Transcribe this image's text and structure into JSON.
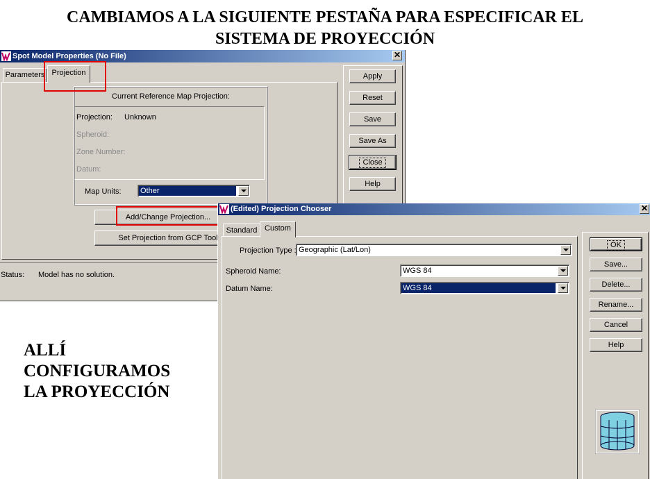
{
  "headings": {
    "line1": "CAMBIAMOS A LA SIGUIENTE PESTAÑA PARA ESPECIFICAR EL",
    "line2": "SISTEMA DE PROYECCIÓN"
  },
  "side_note": {
    "line1": "ALLÍ",
    "line2": "CONFIGURAMOS",
    "line3": "LA PROYECCIÓN"
  },
  "spot_window": {
    "title": "Spot Model Properties (No File)",
    "close_glyph": "✕",
    "tabs": [
      {
        "label": "Parameters",
        "active": false
      },
      {
        "label": "Projection",
        "active": true
      }
    ],
    "group_title": "Current Reference Map Projection:",
    "fields": {
      "projection_label": "Projection:",
      "projection_value": "Unknown",
      "spheroid_label": "Spheroid:",
      "zone_label": "Zone Number:",
      "datum_label": "Datum:"
    },
    "map_units": {
      "label": "Map Units:",
      "value": "Other"
    },
    "buttons": {
      "add_change": "Add/Change Projection...",
      "set_from_gcp": "Set Projection from GCP Tool"
    },
    "side_buttons": {
      "apply": "Apply",
      "reset": "Reset",
      "save": "Save",
      "save_as": "Save As",
      "close": "Close",
      "help": "Help"
    },
    "status": {
      "label": "Status:",
      "value": "Model has no solution."
    }
  },
  "chooser_window": {
    "title": "(Edited) Projection Chooser",
    "close_glyph": "✕",
    "tabs": [
      {
        "label": "Standard",
        "active": false
      },
      {
        "label": "Custom",
        "active": true
      }
    ],
    "projection_type": {
      "label": "Projection Type :",
      "value": "Geographic (Lat/Lon)"
    },
    "spheroid": {
      "label": "Spheroid Name:",
      "value": "WGS 84"
    },
    "datum": {
      "label": "Datum Name:",
      "value": "WGS 84"
    },
    "buttons": {
      "ok": "OK",
      "save": "Save...",
      "delete": "Delete...",
      "rename": "Rename...",
      "cancel": "Cancel",
      "help": "Help"
    }
  },
  "colors": {
    "title_active": "#0a246a",
    "title_fade": "#a6caf0",
    "highlight_box": "#e00000",
    "window_face": "#d4d0c8"
  },
  "icons": [
    "app-logo-icon",
    "close-icon",
    "dropdown-arrow-icon",
    "globe-grid-icon"
  ]
}
